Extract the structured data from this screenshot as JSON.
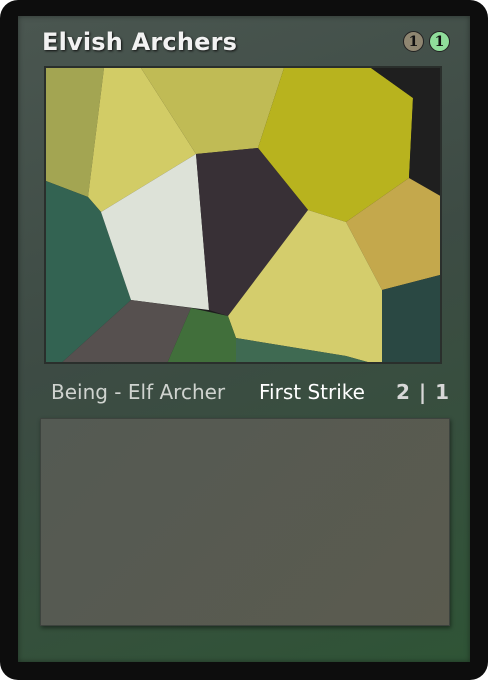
{
  "card": {
    "name": "Elvish Archers",
    "cost": [
      {
        "symbol": "1",
        "kind": "generic",
        "color": "#8f8671",
        "icon": "generic-mana-icon"
      },
      {
        "symbol": "1",
        "kind": "green",
        "color": "#8fdd9a",
        "icon": "green-mana-icon"
      }
    ],
    "art_icon": "polygon-mosaic-art",
    "type_line": "Being - Elf Archer",
    "keyword": "First Strike",
    "power_toughness": "2 | 1",
    "rules_text": ""
  },
  "colors": {
    "frame": "#0d0d0d",
    "inner": "#3d4b44",
    "text_box": "#575a51"
  }
}
